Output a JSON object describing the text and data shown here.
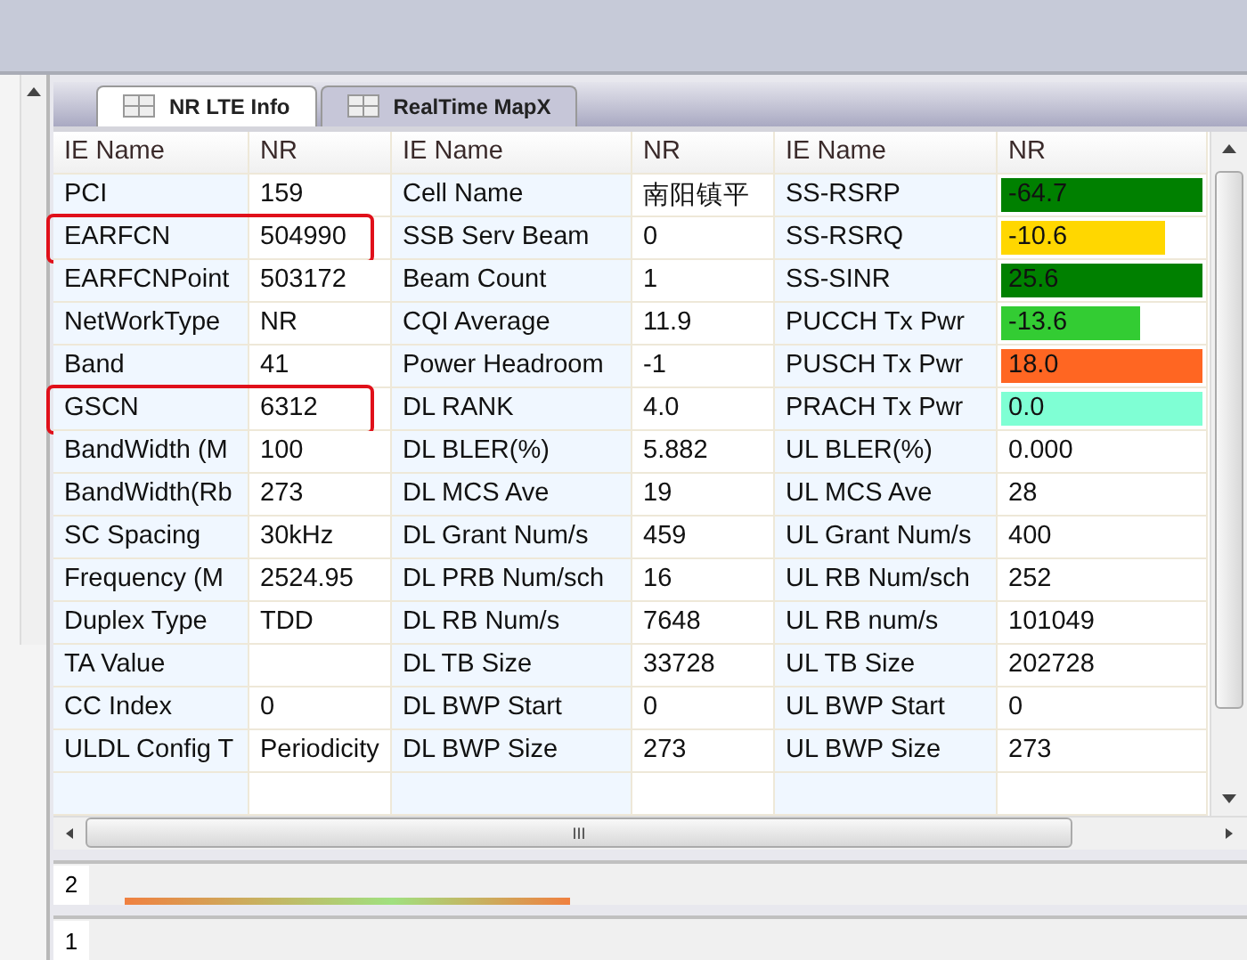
{
  "tabs": [
    {
      "label": "NR LTE Info",
      "selected": true
    },
    {
      "label": "RealTime MapX",
      "selected": false
    }
  ],
  "columns": [
    "IE Name",
    "NR",
    "IE Name",
    "NR",
    "IE Name",
    "NR"
  ],
  "rows": [
    {
      "highlighted": false,
      "cells": [
        {
          "name": "PCI",
          "value": "159"
        },
        {
          "name": "Cell Name",
          "value": "南阳镇平"
        },
        {
          "name": "SS-RSRP",
          "value": "-64.7",
          "color": "#008000",
          "level": 1
        }
      ]
    },
    {
      "highlighted": true,
      "cells": [
        {
          "name": "EARFCN",
          "value": "504990"
        },
        {
          "name": "SSB Serv Beam",
          "value": "0"
        },
        {
          "name": "SS-RSRQ",
          "value": "-10.6",
          "color": "#ffd700",
          "level": 0.82
        }
      ]
    },
    {
      "highlighted": false,
      "cells": [
        {
          "name": "EARFCNPoint",
          "value": "503172"
        },
        {
          "name": "Beam Count",
          "value": "1"
        },
        {
          "name": "SS-SINR",
          "value": "25.6",
          "color": "#008000",
          "level": 1
        }
      ]
    },
    {
      "highlighted": false,
      "cells": [
        {
          "name": "NetWorkType",
          "value": "NR"
        },
        {
          "name": "CQI Average",
          "value": "11.9"
        },
        {
          "name": "PUCCH Tx Pwr",
          "value": "-13.6",
          "color": "#33cc33",
          "level": 0.7
        }
      ]
    },
    {
      "highlighted": false,
      "cells": [
        {
          "name": "Band",
          "value": "41"
        },
        {
          "name": "Power Headroom",
          "value": "-1"
        },
        {
          "name": "PUSCH Tx Pwr",
          "value": "18.0",
          "color": "#ff6622",
          "level": 1
        }
      ]
    },
    {
      "highlighted": true,
      "cells": [
        {
          "name": "GSCN",
          "value": "6312"
        },
        {
          "name": "DL RANK",
          "value": "4.0"
        },
        {
          "name": "PRACH Tx Pwr",
          "value": "0.0",
          "color": "#7fffd4",
          "level": 1
        }
      ]
    },
    {
      "highlighted": false,
      "cells": [
        {
          "name": "BandWidth (M",
          "value": "100"
        },
        {
          "name": "DL BLER(%)",
          "value": "5.882"
        },
        {
          "name": "UL BLER(%)",
          "value": "0.000"
        }
      ]
    },
    {
      "highlighted": false,
      "cells": [
        {
          "name": "BandWidth(Rb",
          "value": "273"
        },
        {
          "name": "DL MCS Ave",
          "value": "19"
        },
        {
          "name": "UL MCS Ave",
          "value": "28"
        }
      ]
    },
    {
      "highlighted": false,
      "cells": [
        {
          "name": "SC Spacing",
          "value": "30kHz"
        },
        {
          "name": "DL Grant Num/s",
          "value": "459"
        },
        {
          "name": "UL Grant Num/s",
          "value": "400"
        }
      ]
    },
    {
      "highlighted": false,
      "cells": [
        {
          "name": "Frequency (M",
          "value": "2524.95"
        },
        {
          "name": "DL PRB Num/sch",
          "value": "16"
        },
        {
          "name": "UL RB Num/sch",
          "value": "252"
        }
      ]
    },
    {
      "highlighted": false,
      "cells": [
        {
          "name": "Duplex Type",
          "value": "TDD"
        },
        {
          "name": "DL RB Num/s",
          "value": "7648"
        },
        {
          "name": "UL RB num/s",
          "value": "101049"
        }
      ]
    },
    {
      "highlighted": false,
      "cells": [
        {
          "name": "TA Value"
        },
        {
          "name": "DL TB Size",
          "value": "33728"
        },
        {
          "name": "UL TB Size",
          "value": "202728"
        }
      ]
    },
    {
      "highlighted": false,
      "cells": [
        {
          "name": "CC Index",
          "value": "0"
        },
        {
          "name": "DL BWP Start",
          "value": "0"
        },
        {
          "name": "UL BWP Start",
          "value": "0"
        }
      ]
    },
    {
      "highlighted": false,
      "cells": [
        {
          "name": "ULDL Config T",
          "value": "Periodicity"
        },
        {
          "name": "DL BWP Size",
          "value": "273"
        },
        {
          "name": "UL BWP Size",
          "value": "273"
        }
      ]
    }
  ],
  "scroll_grip": "III",
  "lower_panels": [
    {
      "label": "2"
    },
    {
      "label": "1"
    }
  ]
}
